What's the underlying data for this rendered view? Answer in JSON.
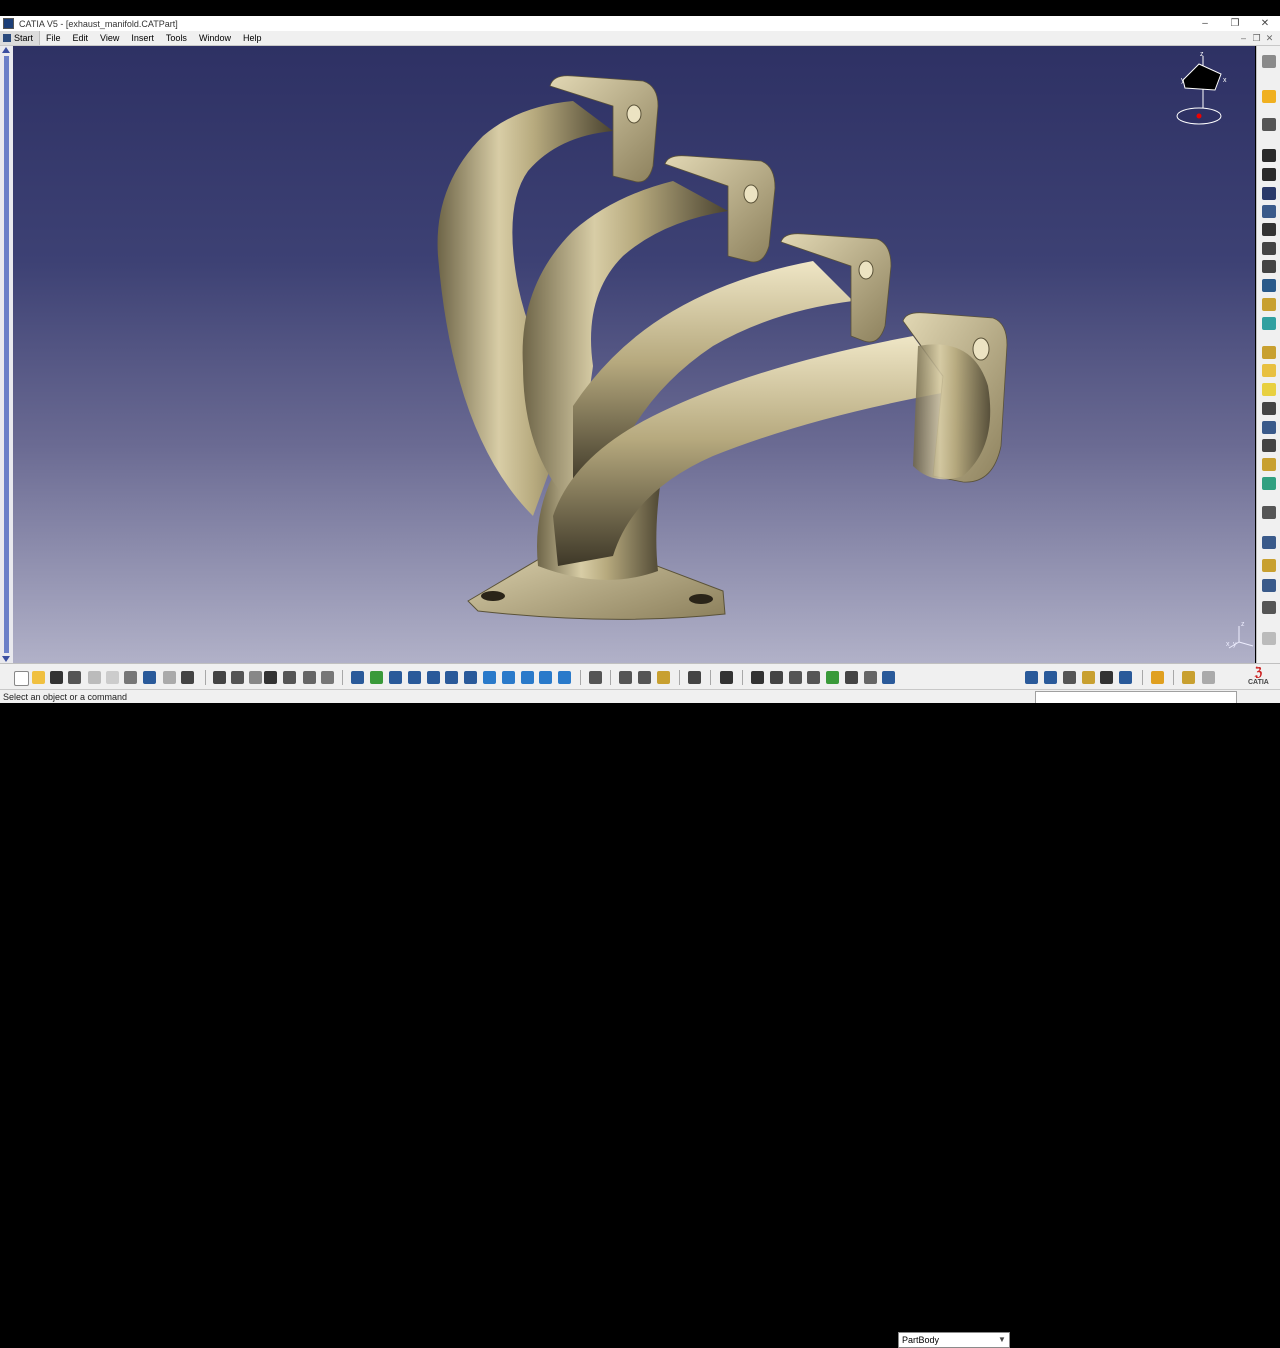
{
  "window": {
    "title": "CATIA V5 - [exhaust_manifold.CATPart]"
  },
  "menu": {
    "start": "Start",
    "items": [
      "File",
      "Edit",
      "View",
      "Insert",
      "Tools",
      "Window",
      "Help"
    ]
  },
  "toolbar": {
    "body_select": "PartBody"
  },
  "status": {
    "message": "Select an object or a command"
  },
  "compass": {
    "z": "z",
    "x": "x",
    "y": "y"
  },
  "axis": {
    "z": "z",
    "x": "x",
    "y": "y"
  },
  "brand": {
    "logo": "CATIA"
  },
  "colors": {
    "viewport_top": "#2e3164",
    "viewport_bottom": "#b1b1c8",
    "part_metal": "#c9bc93"
  }
}
